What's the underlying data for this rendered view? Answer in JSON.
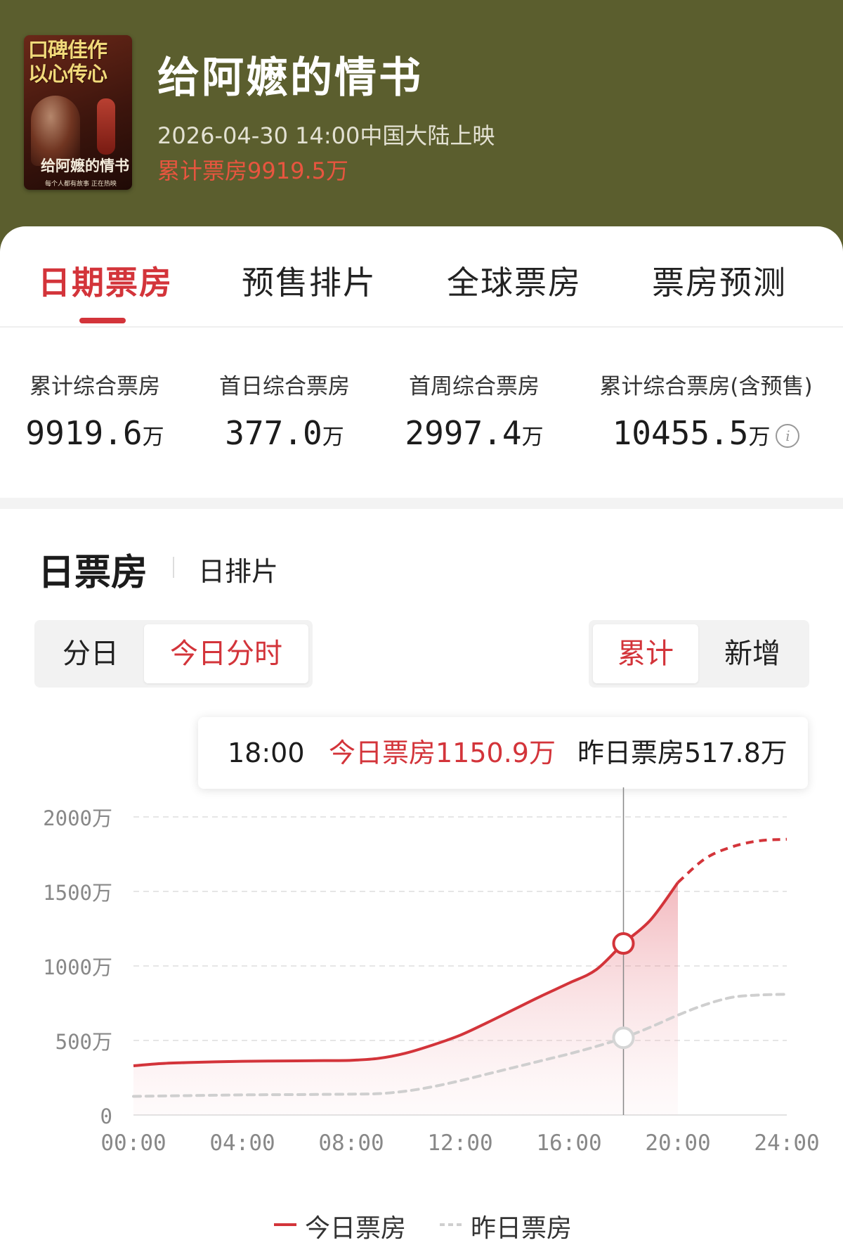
{
  "movie": {
    "poster": {
      "slogan_line1": "口碑佳作",
      "slogan_line2": "以心传心",
      "title_art": "给阿嬷的情书",
      "caption": "每个人都有故事 正在热映"
    },
    "title": "给阿嬷的情书",
    "release": "2026-04-30 14:00中国大陆上映",
    "total_box": "累计票房9919.5万"
  },
  "tabs": [
    {
      "label": "日期票房",
      "active": true
    },
    {
      "label": "预售排片",
      "active": false
    },
    {
      "label": "全球票房",
      "active": false
    },
    {
      "label": "票房预测",
      "active": false
    }
  ],
  "stats": [
    {
      "label": "累计综合票房",
      "value": "9919.6",
      "unit": "万"
    },
    {
      "label": "首日综合票房",
      "value": "377.0",
      "unit": "万"
    },
    {
      "label": "首周综合票房",
      "value": "2997.4",
      "unit": "万"
    },
    {
      "label": "累计综合票房(含预售)",
      "value": "10455.5",
      "unit": "万",
      "info_icon": "info-circle-icon"
    }
  ],
  "section": {
    "title": "日票房",
    "subtitle": "日排片"
  },
  "toggle_left": [
    {
      "label": "分日",
      "active": false
    },
    {
      "label": "今日分时",
      "active": true
    }
  ],
  "toggle_right": [
    {
      "label": "累计",
      "active": true
    },
    {
      "label": "新增",
      "active": false
    }
  ],
  "tooltip": {
    "time": "18:00",
    "today": "今日票房1150.9万",
    "yesterday": "昨日票房517.8万"
  },
  "legend": [
    {
      "label": "今日票房",
      "style": "solid",
      "color": "#d3343a"
    },
    {
      "label": "昨日票房",
      "style": "dashed",
      "color": "#cfcfcf"
    }
  ],
  "colors": {
    "accent": "#d3343a",
    "header_bg": "#5b5e2e",
    "yesterday_line": "#cfcfcf"
  },
  "chart_data": {
    "type": "line",
    "x_ticks": [
      "00:00",
      "04:00",
      "08:00",
      "12:00",
      "16:00",
      "20:00",
      "24:00"
    ],
    "y_ticks": [
      "0",
      "500万",
      "1000万",
      "1500万",
      "2000万"
    ],
    "ylim": [
      0,
      2000
    ],
    "xlim": [
      0,
      24
    ],
    "grid": true,
    "legend_position": "bottom-center",
    "series": [
      {
        "name": "今日票房",
        "style": "solid",
        "x": [
          0,
          1,
          2,
          3,
          4,
          5,
          6,
          7,
          8,
          9,
          10,
          11,
          12,
          13,
          14,
          15,
          16,
          17,
          18,
          19,
          20
        ],
        "y": [
          330,
          345,
          352,
          357,
          360,
          362,
          363,
          365,
          367,
          380,
          415,
          470,
          535,
          620,
          710,
          800,
          885,
          975,
          1150.9,
          1310,
          1560
        ]
      },
      {
        "name": "今日票房",
        "style": "dashed",
        "x": [
          20,
          21,
          22,
          23,
          24
        ],
        "y": [
          1560,
          1720,
          1800,
          1840,
          1850
        ]
      },
      {
        "name": "昨日票房",
        "style": "dashed",
        "x": [
          0,
          2,
          4,
          6,
          8,
          9,
          10,
          11,
          12,
          13,
          14,
          15,
          16,
          17,
          18,
          19,
          20,
          21,
          22,
          23,
          24
        ],
        "y": [
          125,
          130,
          135,
          137,
          140,
          143,
          160,
          190,
          230,
          275,
          320,
          365,
          410,
          460,
          517.8,
          590,
          670,
          740,
          790,
          805,
          810
        ]
      }
    ],
    "highlight": {
      "x": 18,
      "today": 1150.9,
      "yesterday": 517.8
    }
  }
}
